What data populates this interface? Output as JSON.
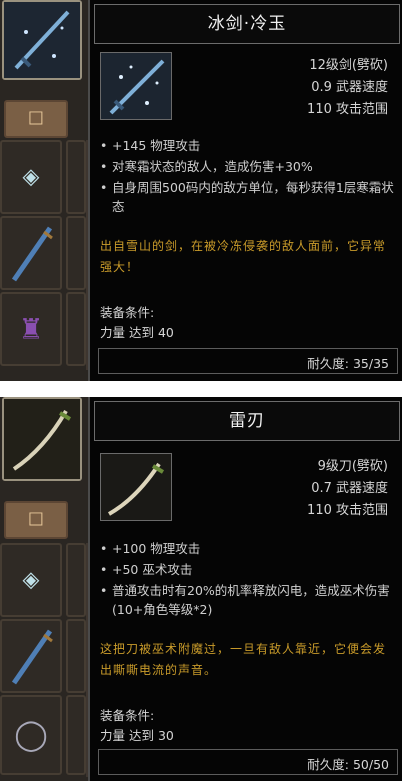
{
  "panels": [
    {
      "item": {
        "name": "冰剑·冷玉",
        "level_type": "12级剑(劈砍)",
        "speed": "0.9 武器速度",
        "range": "110 攻击范围",
        "icon": "ice-sword-icon"
      },
      "effects": [
        "+145 物理攻击",
        "对寒霜状态的敌人，造成伤害+30%",
        "自身周围500码内的敌方单位，每秒获得1层寒霜状态"
      ],
      "lore": "出自雪山的剑，在被冷冻侵袭的敌人面前，它异常强大！",
      "requirements": {
        "label": "装备条件:",
        "value": "力量 达到 40"
      },
      "durability": "耐久度: 35/35",
      "inventory_icons": [
        "sword-icon",
        "tab-icon",
        "scarf-icon",
        "blade-icon",
        "armor-icon"
      ]
    },
    {
      "item": {
        "name": "雷刃",
        "level_type": "9级刀(劈砍)",
        "speed": "0.7 武器速度",
        "range": "110 攻击范围",
        "icon": "curved-blade-icon"
      },
      "effects": [
        "+100 物理攻击",
        "+50 巫术攻击",
        "普通攻击时有20%的机率释放闪电，造成巫术伤害(10+角色等级*2)"
      ],
      "lore": "这把刀被巫术附魔过，一旦有敌人靠近，它便会发出嘶嘶电流的声音。",
      "requirements": {
        "label": "装备条件:",
        "value": "力量 达到 30"
      },
      "durability": "耐久度: 50/50",
      "inventory_icons": [
        "curved-blade-icon",
        "tab-icon",
        "scarf-icon",
        "blade-icon",
        "bracelet-icon"
      ]
    }
  ],
  "colors": {
    "lore": "#c99b2a",
    "panel_bg": "#050505",
    "border": "#6c6c6c"
  }
}
